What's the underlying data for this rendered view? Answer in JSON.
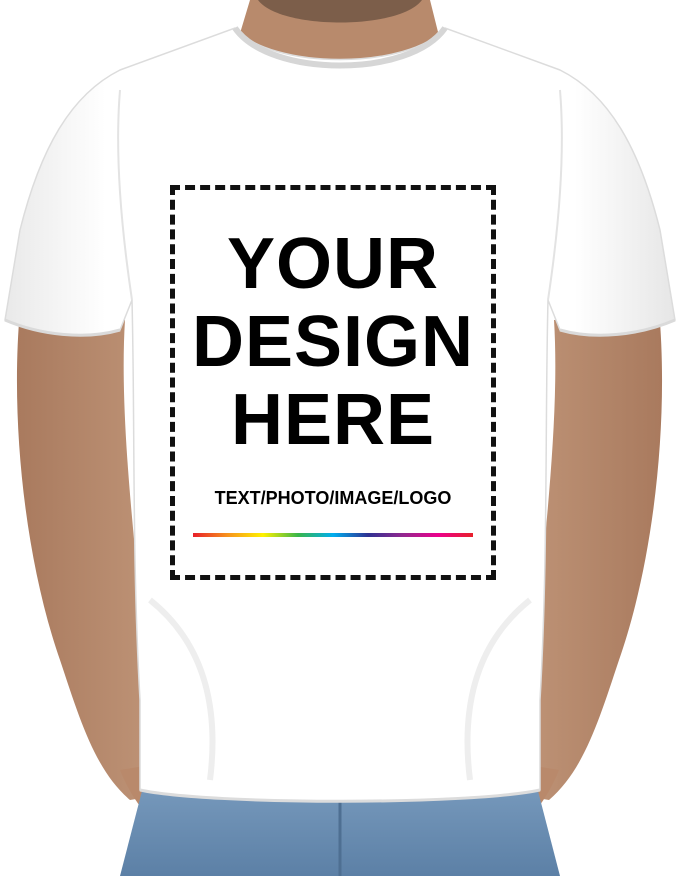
{
  "print_area": {
    "headline": [
      "YOUR",
      "DESIGN",
      "HERE"
    ],
    "subtitle": "TEXT/PHOTO/IMAGE/LOGO",
    "rainbow_colors": [
      "#e8202a",
      "#f7941d",
      "#fff200",
      "#39b54a",
      "#00aeef",
      "#2e3192",
      "#92278f",
      "#ec008c",
      "#e8202a"
    ]
  },
  "colors": {
    "shirt": "#ffffff",
    "skin": "#b98b6f",
    "jeans": "#6e93b8",
    "border": "#111111"
  }
}
